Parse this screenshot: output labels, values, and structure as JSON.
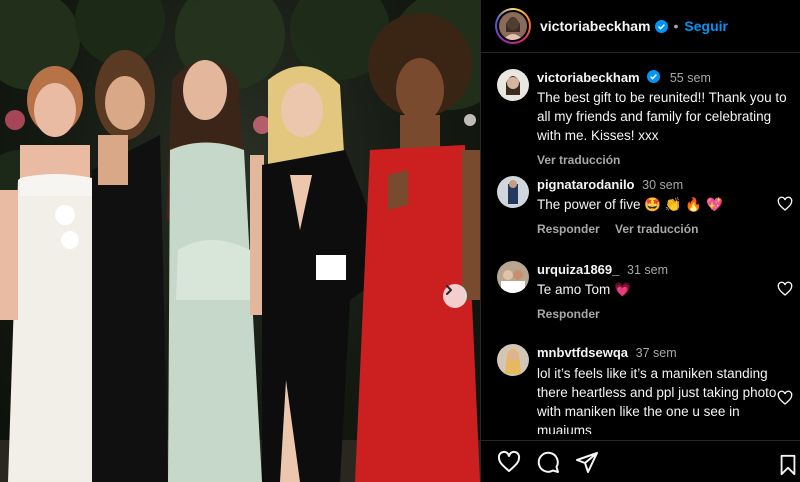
{
  "post": {
    "username": "victoriabeckham",
    "follow_label": "Seguir",
    "caption_time": "55 sem",
    "caption_text": "The best gift to be reunited!! Thank you to all my friends and family for celebrating with me. Kisses! xxx",
    "translate_label": "Ver traducción"
  },
  "comments": [
    {
      "username": "pignatarodanilo",
      "time": "30 sem",
      "text": "The power of five 🤩 👏 🔥 💖",
      "reply_label": "Responder",
      "translate_label": "Ver traducción"
    },
    {
      "username": "urquiza1869_",
      "time": "31 sem",
      "text": "Te amo Tom 💗",
      "reply_label": "Responder"
    },
    {
      "username": "mnbvtfdsewqa",
      "time": "37 sem",
      "text": "lol it’s feels like it’s a maniken standing there heartless and ppl just taking photo with maniken like the one u see in muaiums"
    }
  ],
  "icons": [
    "verified-icon",
    "chevron-right-icon",
    "heart-icon",
    "comment-icon",
    "share-icon",
    "bookmark-icon"
  ],
  "colors": {
    "link": "#0095f6",
    "verified": "#0095f6",
    "muted": "#a8a8a8",
    "background": "#000000"
  }
}
